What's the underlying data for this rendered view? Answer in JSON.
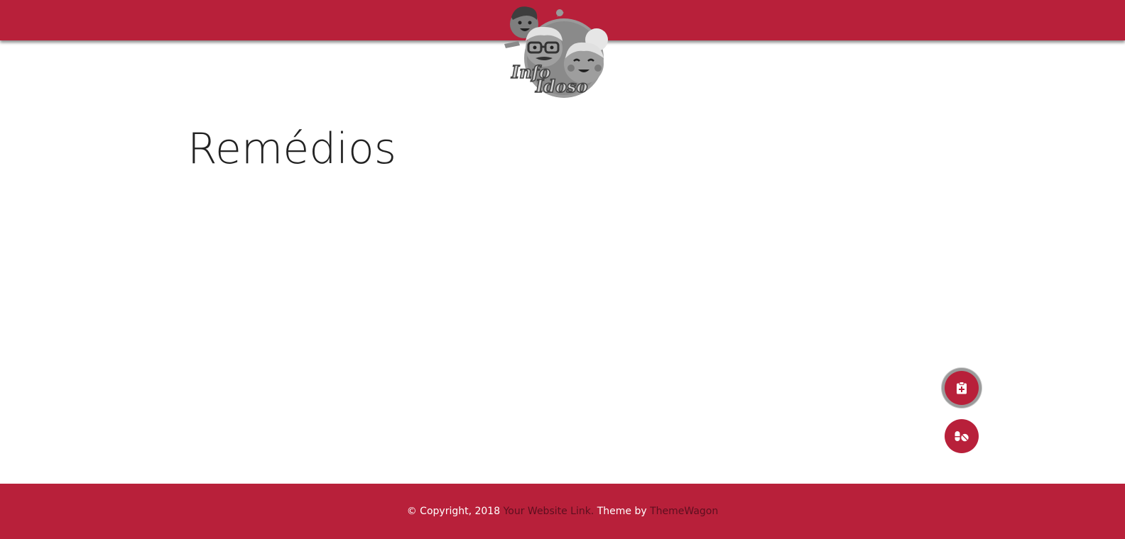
{
  "header": {
    "logo": {
      "icon": "info-idoso-logo-icon",
      "line1": "Info",
      "line2": "Idoso"
    }
  },
  "main": {
    "title": "Remédios"
  },
  "actions": {
    "record_icon": "clipboard-medical-icon",
    "pills_icon": "pills-icon"
  },
  "footer": {
    "copyright": "© Copyright, 2018 ",
    "website_link": "Your Website Link.",
    "theme_prefix": " Theme by ",
    "theme_link": "ThemeWagon"
  },
  "colors": {
    "brand": "#b8203a",
    "footer_link": "#5c0f1f",
    "title_text": "#222222"
  }
}
